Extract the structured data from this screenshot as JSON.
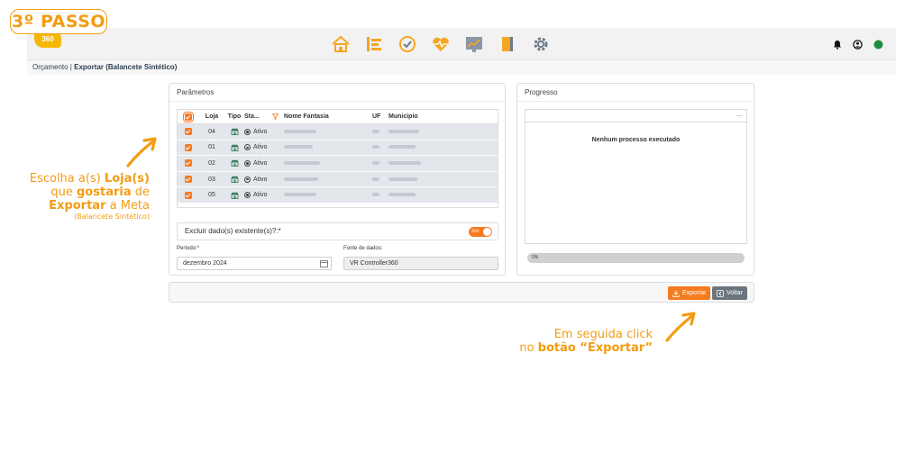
{
  "step_badge": "3º PASSO",
  "topbar": {
    "logo": "360",
    "nav_icons": [
      "home-icon",
      "list-icon",
      "check-circle-icon",
      "heart-pulse-icon",
      "chart-icon",
      "book-icon",
      "gear-icon"
    ],
    "right_icons": [
      "bell-icon",
      "user-icon",
      "status-dot-icon"
    ]
  },
  "breadcrumb": {
    "module": "Orçamento",
    "separator": " | ",
    "page": "Exportar (Balancete Sintético)"
  },
  "params": {
    "title": "Parâmetros",
    "columns": {
      "loja": "Loja",
      "tipo": "Tipo",
      "status": "Sta...",
      "nome": "Nome Fantasia",
      "uf": "UF",
      "municipio": "Municipio"
    },
    "rows": [
      {
        "loja": "04",
        "status": "Ativo"
      },
      {
        "loja": "01",
        "status": "Ativo"
      },
      {
        "loja": "02",
        "status": "Ativo"
      },
      {
        "loja": "03",
        "status": "Ativo"
      },
      {
        "loja": "05",
        "status": "Ativo"
      }
    ],
    "excluir_label": "Excluir dado(s) existente(s)?:*",
    "excluir_toggle": "Sim",
    "periodo_label": "Período:*",
    "periodo_value": "dezembro 2024",
    "fonte_label": "Fonte de dados:",
    "fonte_value": "VR Controller360"
  },
  "progress": {
    "title": "Progresso",
    "menu": "...",
    "message": "Nenhum processo executado",
    "percent_label": "0%",
    "percent": 0
  },
  "footer": {
    "export_label": "Exportar",
    "back_label": "Voltar"
  },
  "annotations": {
    "left": {
      "l1a": "Escolha a(s) ",
      "l1b": "Loja(s)",
      "l2a": "que ",
      "l2b": "gostaria",
      "l2c": " de",
      "l3a": "Exportar",
      "l3b": " a Meta",
      "l4": "(Balancete Sintético)"
    },
    "right": {
      "l1": "Em seguida click",
      "l2a": "no ",
      "l2b": "botão “Exportar”"
    }
  },
  "colors": {
    "accent": "#f47b20",
    "annotation": "#f39c12",
    "row_bg": "#e3e7ec",
    "status_dot": "#1e8e3e"
  }
}
